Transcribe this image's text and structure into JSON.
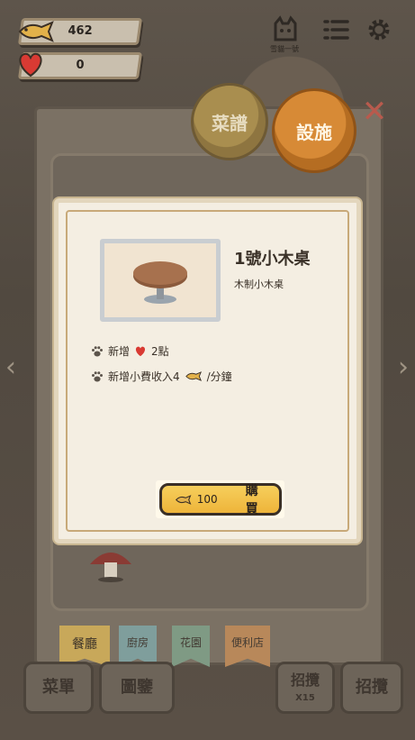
{
  "hud": {
    "fish_count": "462",
    "heart_count": "0",
    "shop_name": "雪貓一號"
  },
  "tabs": {
    "recipe": "菜譜",
    "facility": "設施"
  },
  "item": {
    "title": "1號小木桌",
    "description": "木制小木桌",
    "effect1_prefix": "新增",
    "effect1_suffix": "2點",
    "effect2_prefix": "新增小費收入4",
    "effect2_suffix": "/分鐘",
    "price": "100",
    "buy_label": "購買"
  },
  "bottom_tabs": {
    "restaurant": "餐廳",
    "kitchen": "廚房",
    "garden": "花園",
    "store": "便利店"
  },
  "bottom_buttons": {
    "menu": "菜單",
    "guide": "圖鑒",
    "recruit_multi": "招攬",
    "recruit_multi_count": "X15",
    "recruit": "招攬"
  },
  "colors": {
    "accent_gold": "#eeb43a",
    "heart_red": "#d93a33",
    "fish_gold": "#e2b14a",
    "facility_orange": "#d78a36"
  }
}
